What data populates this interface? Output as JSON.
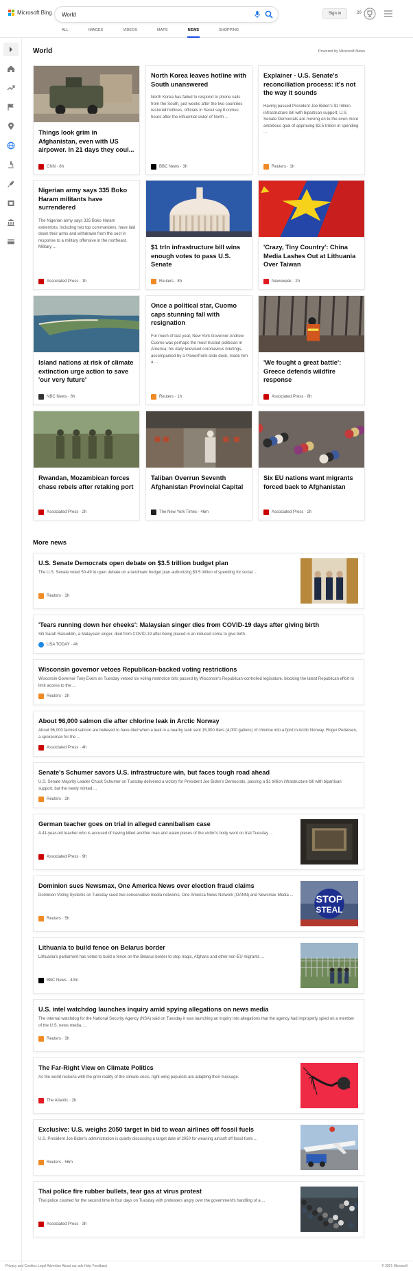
{
  "header": {
    "logo_text": "Microsoft Bing",
    "search_value": "World",
    "signin_label": "Sign in",
    "rewards_count": "20",
    "tabs": [
      {
        "label": "ALL"
      },
      {
        "label": "IMAGES"
      },
      {
        "label": "VIDEOS"
      },
      {
        "label": "MAPS"
      },
      {
        "label": "NEWS"
      },
      {
        "label": "SHOPPING"
      }
    ],
    "active_tab": "NEWS"
  },
  "section": {
    "title": "World",
    "powered_by": "Powered by Microsoft News"
  },
  "cards": [
    {
      "title": "Things look grim in Afghanistan, even with US airpower. In 21 days they coul...",
      "source": "CNN",
      "age": "8h",
      "logo_color": "#cc0000",
      "image": "military vehicle in street"
    },
    {
      "title": "North Korea leaves hotline with South unanswered",
      "snippet": "North Korea has failed to respond to phone calls from the South, just weeks after the two countries restored hotlines, officials in Seoul say.It comes hours after the influential sister of North ...",
      "source": "BBC News",
      "age": "3h",
      "logo_color": "#000000"
    },
    {
      "title": "Explainer - U.S. Senate's reconciliation process: it's not the way it sounds",
      "snippet": "Having passed President Joe Biden's $1 trillion infrastructure bill with bipartisan support, U.S. Senate Democrats are moving on to the even more ambitious goal of approving $3.5 trillion in spending ...",
      "source": "Reuters",
      "age": "1h",
      "logo_color": "#f08a24"
    },
    {
      "title": "Nigerian army says 335 Boko Haram militants have surrendered",
      "snippet": "The Nigerian army says 335 Boko Haram extremists, including two top commanders, have laid down their arms and withdrawn from the sect in response to a military offensive in the northeast. Military ...",
      "source": "Associated Press",
      "age": "1h",
      "logo_color": "#cc0000"
    },
    {
      "title": "$1 trln infrastructure bill wins enough votes to pass U.S. Senate",
      "source": "Reuters",
      "age": "8h",
      "logo_color": "#f08a24",
      "image": "capitol dome"
    },
    {
      "title": "'Crazy, Tiny Country': China Media Lashes Out at Lithuania Over Taiwan",
      "source": "Newsweek",
      "age": "2h",
      "logo_color": "#e01b22",
      "image": "flags"
    },
    {
      "title": "Island nations at risk of climate extinction urge action to save 'our very future'",
      "source": "NBC News",
      "age": "6h",
      "logo_color": "#333333",
      "image": "island coastline"
    },
    {
      "title": "Once a political star, Cuomo caps stunning fall with resignation",
      "snippet": "For much of last year, New York Governor Andrew Cuomo was perhaps the most trusted politician in America; his daily televised coronavirus briefings, accompanied by a PowerPoint slide deck, made him a ...",
      "source": "Reuters",
      "age": "1h",
      "logo_color": "#f08a24"
    },
    {
      "title": "'We fought a great battle': Greece defends wildfire response",
      "source": "Associated Press",
      "age": "8h",
      "logo_color": "#cc0000",
      "image": "firefighter in forest"
    },
    {
      "title": "Rwandan, Mozambican forces chase rebels after retaking port",
      "source": "Associated Press",
      "age": "2h",
      "logo_color": "#cc0000",
      "image": "soldiers"
    },
    {
      "title": "Taliban Overrun Seventh Afghanistan Provincial Capital",
      "source": "The New York Times",
      "age": "46m",
      "logo_color": "#222222",
      "image": "market street"
    },
    {
      "title": "Six EU nations want migrants forced back to Afghanistan",
      "source": "Associated Press",
      "age": "2h",
      "logo_color": "#cc0000",
      "image": "crowd of migrants"
    }
  ],
  "more_news": {
    "title": "More news",
    "items": [
      {
        "title": "U.S. Senate Democrats open debate on $3.5 trillion budget plan",
        "snippet": "The U.S. Senate voted 50-49 to open debate on a landmark budget plan authorizing $3.5 trillion of spending for social ...",
        "source": "Reuters",
        "age": "1h",
        "logo_color": "#f08a24",
        "image": "senate hallway"
      },
      {
        "title": "'Tears running down her cheeks': Malaysian singer dies from COVID-19 days after giving birth",
        "snippet": "Siti Sarah Raisuddin, a Malaysian singer, died from COVID-19 after being placed in an induced coma to give birth.",
        "source": "USA TODAY",
        "age": "4h",
        "logo_color": "#1e88e5"
      },
      {
        "title": "Wisconsin governor vetoes Republican-backed voting restrictions",
        "snippet": "Wisconsin Governor Tony Evers on Tuesday vetoed six voting restriction bills passed by Wisconsin's Republican-controlled legislature, blocking the latest Republican effort to limit access to the ...",
        "source": "Reuters",
        "age": "2h",
        "logo_color": "#f08a24"
      },
      {
        "title": "About 96,000 salmon die after chlorine leak in Arctic Norway",
        "snippet": "About 96,000 farmed salmon are believed to have died when a leak in a nearby tank sent 15,000 liters (4,000 gallons) of chlorine into a fjord in Arctic Norway. Roger Pedersen, a spokesman for the ...",
        "source": "Associated Press",
        "age": "4h",
        "logo_color": "#cc0000"
      },
      {
        "title": "Senate's Schumer savors U.S. infrastructure win, but faces tough road ahead",
        "snippet": "U.S. Senate Majority Leader Chuck Schumer on Tuesday delivered a victory for President Joe Biden's Democrats, passing a $1 trillion infrastructure bill with bipartisan support, but the newly minted ...",
        "source": "Reuters",
        "age": "2h",
        "logo_color": "#f08a24"
      },
      {
        "title": "German teacher goes on trial in alleged cannibalism case",
        "snippet": "A 41-year-old teacher who is accused of having killed another man and eaten pieces of the victim's body went on trial Tuesday ...",
        "source": "Associated Press",
        "age": "9h",
        "logo_color": "#cc0000",
        "image": "courtroom"
      },
      {
        "title": "Dominion sues Newsmax, One America News over election fraud claims",
        "snippet": "Dominion Voting Systems on Tuesday sued two conservative media networks, One America News Network (OANN) and Newsmax Media ...",
        "source": "Reuters",
        "age": "5h",
        "logo_color": "#f08a24",
        "image": "stop the steal sign"
      },
      {
        "title": "Lithuania to build fence on Belarus border",
        "snippet": "Lithuania's parliament has voted to build a fence on the Belarus border to stop Iraqis, Afghans and other non-EU migrants ...",
        "source": "BBC News",
        "age": "40m",
        "logo_color": "#000000",
        "image": "border fence"
      },
      {
        "title": "U.S. intel watchdog launches inquiry amid spying allegations on news media",
        "snippet": "The internal watchdog for the National Security Agency (NSA) said on Tuesday it was launching an inquiry into allegations that the agency had improperly spied on a member of the U.S. news media. ...",
        "source": "Reuters",
        "age": "3h",
        "logo_color": "#f08a24"
      },
      {
        "title": "The Far-Right View on Climate Politics",
        "snippet": "As the world reckons with the grim reality of the climate crisis, right-wing populists are adapting their message.",
        "source": "The Atlantic",
        "age": "2h",
        "logo_color": "#e01b22",
        "image": "red illustration"
      },
      {
        "title": "Exclusive: U.S. weighs 2050 target in bid to wean airlines off fossil fuels",
        "snippet": "U.S. President Joe Biden's administration is quietly discussing a target date of 2050 for weaning aircraft off fossil fuels ...",
        "source": "Reuters",
        "age": "56m",
        "logo_color": "#f08a24",
        "image": "airplane refueling"
      },
      {
        "title": "Thai police fire rubber bullets, tear gas at virus protest",
        "snippet": "Thai police clashed for the second time in four days on Tuesday with protesters angry over the government's handling of a ...",
        "source": "Associated Press",
        "age": "3h",
        "logo_color": "#cc0000",
        "image": "protest crowd"
      }
    ]
  },
  "footer": {
    "left": "Privacy and Cookies  Legal  Advertise  About our ads  Help  Feedback",
    "right": "© 2021 Microsoft"
  }
}
